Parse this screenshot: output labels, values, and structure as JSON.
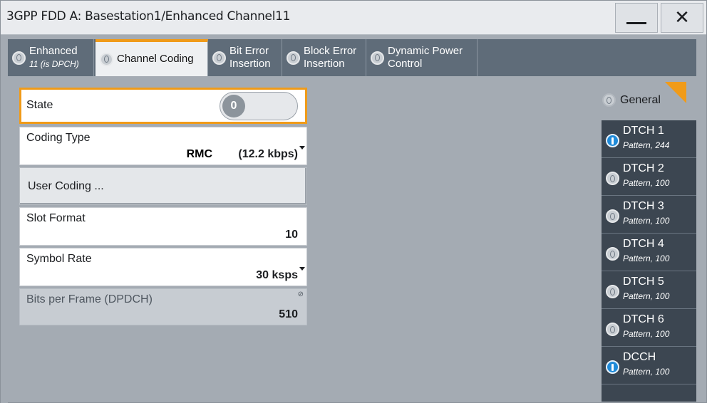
{
  "window": {
    "title": "3GPP FDD A: Basestation1/Enhanced Channel11",
    "minimize_icon": "minimize-icon",
    "close_label": "✕"
  },
  "tabs": [
    {
      "label": "Enhanced",
      "sub": "11 (is DPCH)",
      "active": false
    },
    {
      "label": "Channel Coding",
      "sub": "",
      "active": true
    },
    {
      "label": "Bit Error",
      "sub": "Insertion",
      "active": false
    },
    {
      "label": "Block Error",
      "sub": "Insertion",
      "active": false
    },
    {
      "label": "Dynamic Power",
      "sub": "Control",
      "active": false
    }
  ],
  "form": {
    "state": {
      "label": "State",
      "toggle_value": "0"
    },
    "coding_type": {
      "label": "Coding Type",
      "value_main": "RMC",
      "value_rate": "(12.2 kbps)"
    },
    "user_coding": {
      "label": "User Coding ..."
    },
    "slot_format": {
      "label": "Slot Format",
      "value": "10"
    },
    "symbol_rate": {
      "label": "Symbol Rate",
      "value": "30 ksps"
    },
    "bits_per_frame": {
      "label": "Bits per Frame (DPDCH)",
      "value": "510"
    }
  },
  "sidebar": {
    "general_label": "General",
    "items": [
      {
        "name": "DTCH 1",
        "sub": "Pattern, 244",
        "on": true
      },
      {
        "name": "DTCH 2",
        "sub": "Pattern, 100",
        "on": false
      },
      {
        "name": "DTCH 3",
        "sub": "Pattern, 100",
        "on": false
      },
      {
        "name": "DTCH 4",
        "sub": "Pattern, 100",
        "on": false
      },
      {
        "name": "DTCH 5",
        "sub": "Pattern, 100",
        "on": false
      },
      {
        "name": "DTCH 6",
        "sub": "Pattern, 100",
        "on": false
      },
      {
        "name": "DCCH",
        "sub": "Pattern, 100",
        "on": true
      }
    ]
  },
  "colors": {
    "accent": "#f09b19",
    "tab_bg": "#5f6c79",
    "list_bg": "#3c4651",
    "radio_on": "#1f8ad8"
  }
}
